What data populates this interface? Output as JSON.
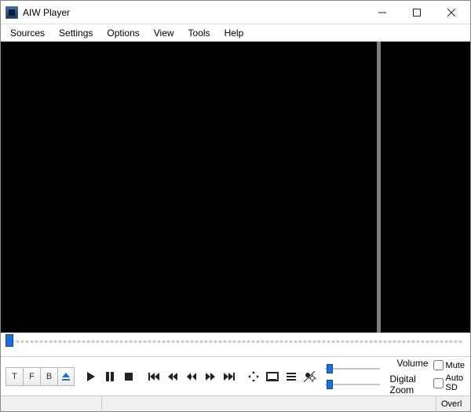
{
  "window": {
    "title": "AIW Player"
  },
  "menu": {
    "sources": "Sources",
    "settings": "Settings",
    "options": "Options",
    "view": "View",
    "tools": "Tools",
    "help": "Help"
  },
  "buttons": {
    "t": "T",
    "f": "F",
    "b": "B"
  },
  "labels": {
    "volume": "Volume",
    "digital_zoom": "Digital Zoom",
    "mute": "Mute",
    "auto_sd": "Auto SD"
  },
  "status": {
    "overlay": "Overl"
  },
  "icons": {
    "min": "minimize",
    "max": "maximize",
    "close": "close",
    "eject": "eject",
    "play": "play",
    "pause": "pause",
    "stop": "stop",
    "skip_back": "skip-back",
    "rewind": "rewind",
    "slow": "slow",
    "fastfwd": "fast-forward",
    "skip_fwd": "skip-forward",
    "move": "move",
    "fullscreen": "fullscreen",
    "list": "list",
    "brightness": "brightness"
  }
}
